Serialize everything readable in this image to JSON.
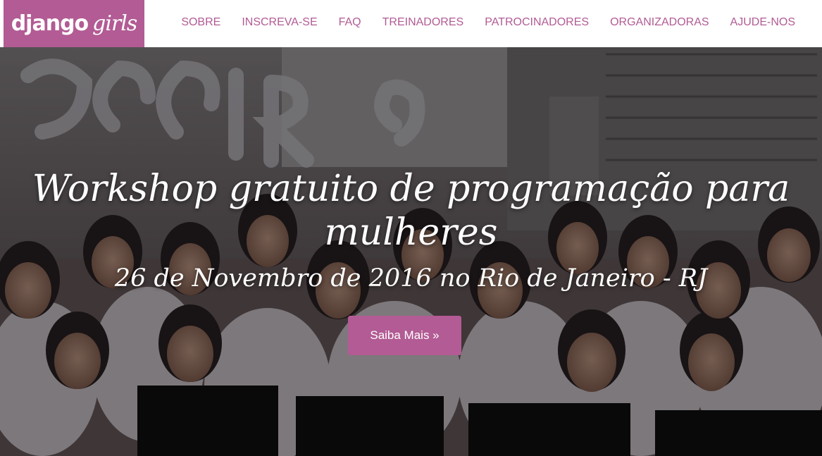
{
  "brand": {
    "name_part1": "django",
    "name_part2": "girls",
    "accent_color": "#b25b94"
  },
  "nav": {
    "items": [
      {
        "label": "SOBRE"
      },
      {
        "label": "INSCREVA-SE"
      },
      {
        "label": "FAQ"
      },
      {
        "label": "TREINADORES"
      },
      {
        "label": "PATROCINADORES"
      },
      {
        "label": "ORGANIZADORAS"
      },
      {
        "label": "AJUDE-NOS"
      }
    ]
  },
  "hero": {
    "title": "Workshop gratuito de programação para mulheres",
    "subtitle": "26 de Novembro de 2016 no Rio de Janeiro - RJ",
    "cta_label": "Saiba Mais »"
  }
}
